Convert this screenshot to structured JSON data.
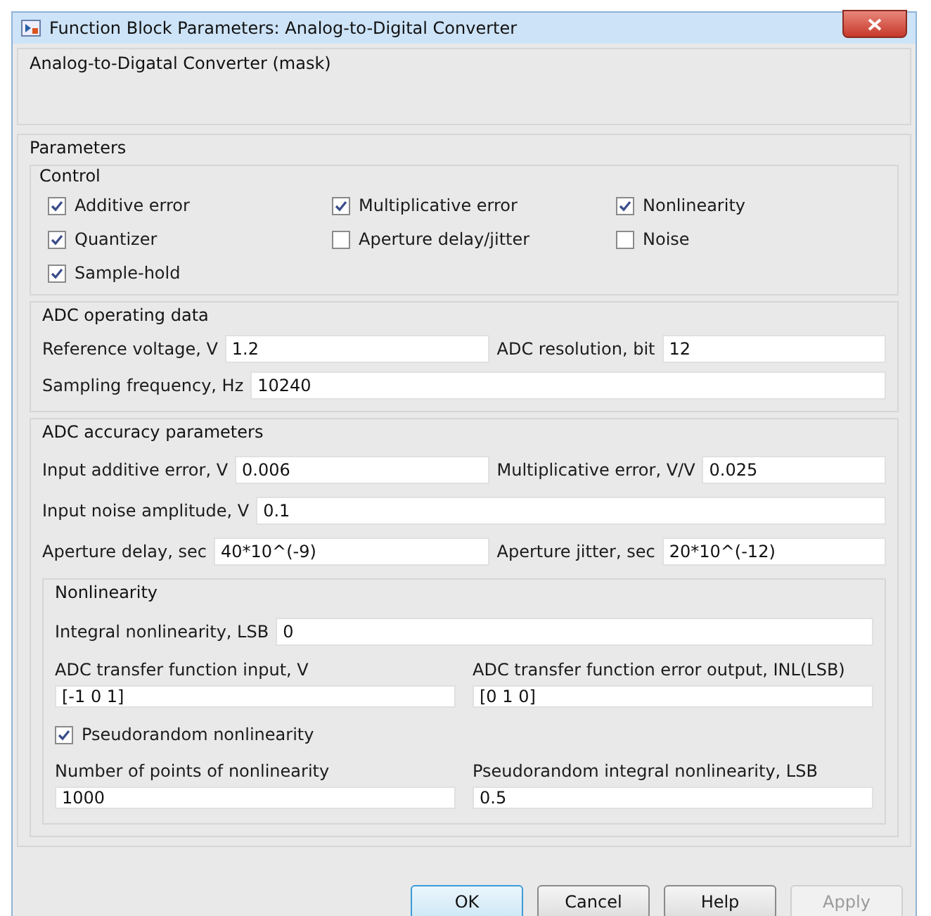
{
  "window": {
    "title": "Function Block Parameters: Analog-to-Digital Converter"
  },
  "mask": {
    "title": "Analog-to-Digatal Converter (mask)"
  },
  "parameters": {
    "title": "Parameters",
    "control": {
      "title": "Control",
      "checkboxes": [
        {
          "label": "Additive error",
          "checked": true
        },
        {
          "label": "Multiplicative error",
          "checked": true
        },
        {
          "label": "Nonlinearity",
          "checked": true
        },
        {
          "label": "Quantizer",
          "checked": true
        },
        {
          "label": "Aperture delay/jitter",
          "checked": false
        },
        {
          "label": "Noise",
          "checked": false
        },
        {
          "label": "Sample-hold",
          "checked": true
        }
      ]
    },
    "operating_data": {
      "title": "ADC operating data",
      "rows": [
        [
          {
            "label": "Reference voltage, V",
            "value": "1.2"
          },
          {
            "label": "ADC resolution, bit",
            "value": "12"
          }
        ],
        [
          {
            "label": "Sampling frequency, Hz",
            "value": "10240"
          }
        ]
      ]
    },
    "accuracy": {
      "title": "ADC accuracy parameters",
      "rows": [
        [
          {
            "label": "Input additive error, V",
            "value": "0.006"
          },
          {
            "label": "Multiplicative error, V/V",
            "value": "0.025"
          }
        ],
        [
          {
            "label": "Input noise amplitude, V",
            "value": "0.1"
          }
        ],
        [
          {
            "label": "Aperture delay, sec",
            "value": "40*10^(-9)"
          },
          {
            "label": "Aperture jitter, sec",
            "value": "20*10^(-12)"
          }
        ]
      ],
      "nonlinearity": {
        "title": "Nonlinearity",
        "items": [
          {
            "kind": "inline",
            "fields": [
              {
                "label": "Integral nonlinearity, LSB",
                "value": "0"
              }
            ]
          },
          {
            "kind": "stacked",
            "fields": [
              {
                "label": "ADC transfer function input, V",
                "value": "[-1 0 1]"
              },
              {
                "label": "ADC transfer function error output, INL(LSB)",
                "value": "[0 1 0]"
              }
            ]
          },
          {
            "kind": "checkbox",
            "label": "Pseudorandom nonlinearity",
            "checked": true
          },
          {
            "kind": "stacked",
            "fields": [
              {
                "label": "Number of points of nonlinearity",
                "value": "1000"
              },
              {
                "label": "Pseudorandom integral nonlinearity, LSB",
                "value": "0.5"
              }
            ]
          }
        ]
      }
    }
  },
  "buttons": [
    {
      "label": "OK",
      "default": true,
      "disabled": false
    },
    {
      "label": "Cancel",
      "default": false,
      "disabled": false
    },
    {
      "label": "Help",
      "default": false,
      "disabled": false
    },
    {
      "label": "Apply",
      "default": false,
      "disabled": true
    }
  ]
}
